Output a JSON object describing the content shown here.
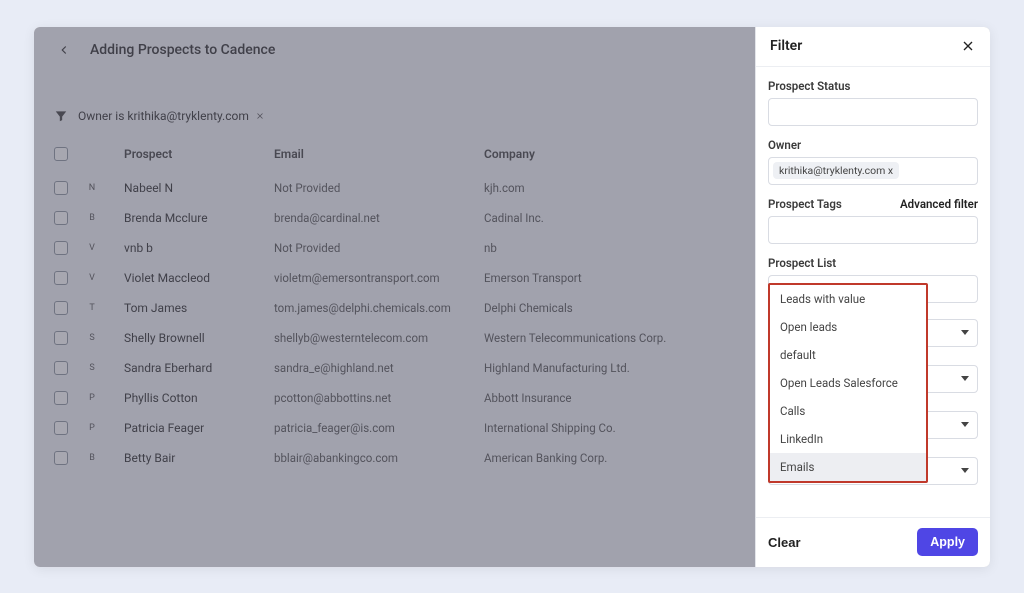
{
  "header": {
    "title": "Adding Prospects to Cadence"
  },
  "active_filter": {
    "text": "Owner is krithika@tryklenty.com"
  },
  "columns": {
    "prospect": "Prospect",
    "email": "Email",
    "company": "Company"
  },
  "rows": [
    {
      "letter": "N",
      "name": "Nabeel N",
      "email": "Not Provided",
      "company": "kjh.com"
    },
    {
      "letter": "B",
      "name": "Brenda Mcclure",
      "email": "brenda@cardinal.net",
      "company": "Cadinal Inc."
    },
    {
      "letter": "V",
      "name": "vnb b",
      "email": "Not Provided",
      "company": "nb"
    },
    {
      "letter": "V",
      "name": "Violet Maccleod",
      "email": "violetm@emersontransport.com",
      "company": "Emerson Transport"
    },
    {
      "letter": "T",
      "name": "Tom James",
      "email": "tom.james@delphi.chemicals.com",
      "company": "Delphi Chemicals"
    },
    {
      "letter": "S",
      "name": "Shelly Brownell",
      "email": "shellyb@westerntelecom.com",
      "company": "Western Telecommunications Corp."
    },
    {
      "letter": "S",
      "name": "Sandra Eberhard",
      "email": "sandra_e@highland.net",
      "company": "Highland Manufacturing Ltd."
    },
    {
      "letter": "P",
      "name": "Phyllis Cotton",
      "email": "pcotton@abbottins.net",
      "company": "Abbott Insurance"
    },
    {
      "letter": "P",
      "name": "Patricia Feager",
      "email": "patricia_feager@is.com",
      "company": "International Shipping Co."
    },
    {
      "letter": "B",
      "name": "Betty Bair",
      "email": "bblair@abankingco.com",
      "company": "American Banking Corp."
    }
  ],
  "filter_panel": {
    "title": "Filter",
    "labels": {
      "prospect_status": "Prospect Status",
      "owner": "Owner",
      "prospect_tags": "Prospect Tags",
      "advanced": "Advanced filter",
      "prospect_list": "Prospect List"
    },
    "owner_tag": "krithika@tryklenty.com x",
    "dropdown_options": [
      "Leads with value",
      "Open leads",
      "default",
      "Open Leads Salesforce",
      "Calls",
      "LinkedIn",
      "Emails"
    ],
    "highlighted_option": "Emails",
    "clear": "Clear",
    "apply": "Apply"
  }
}
